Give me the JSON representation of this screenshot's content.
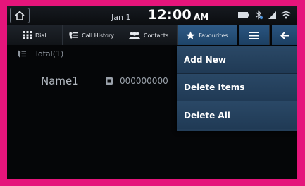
{
  "status": {
    "date": "Jan 1",
    "time": "12:00",
    "ampm": "AM",
    "icons": [
      "battery-icon",
      "bluetooth-icon",
      "signal-icon",
      "wifi-icon"
    ]
  },
  "tabs": {
    "dial": "Dial",
    "call_history": "Call History",
    "contacts": "Contacts",
    "favourites": "Favourites"
  },
  "list": {
    "total": "Total(1)",
    "items": [
      {
        "name": "Name1",
        "number": "000000000"
      }
    ]
  },
  "menu": {
    "items": [
      "Add New",
      "Delete Items",
      "Delete All"
    ]
  },
  "colors": {
    "frame": "#e5157b",
    "selected_tab": "#2e5a86",
    "menu_bg": "#243e59"
  }
}
